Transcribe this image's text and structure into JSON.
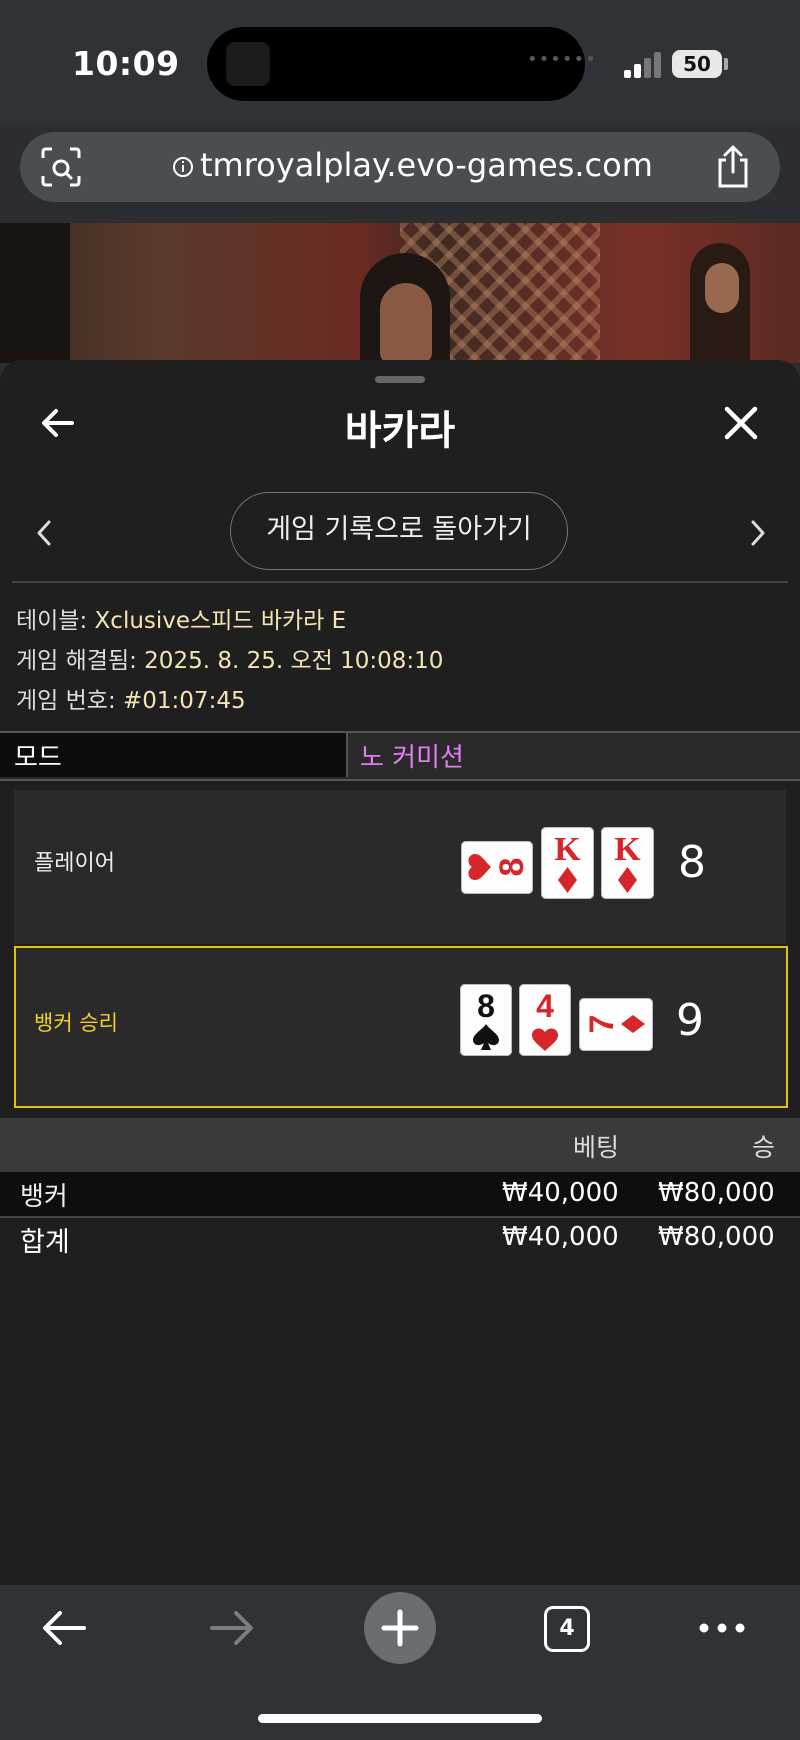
{
  "status_bar": {
    "time": "10:09",
    "battery": "50"
  },
  "browser": {
    "url": "tmroyalplay.evo-games.com"
  },
  "panel": {
    "title": "바카라",
    "history_button": "게임 기록으로 돌아가기",
    "info": {
      "table_label": "테이블: ",
      "table_value": "Xclusive스피드 바카라 E",
      "resolved_label": "게임 해결됨: ",
      "resolved_value": "2025. 8. 25. 오전 10:08:10",
      "round_label": "게임 번호: ",
      "round_value": "#01:07:45"
    },
    "mode": {
      "label": "모드",
      "value": "노 커미션"
    },
    "hands": {
      "player": {
        "label": "플레이어",
        "score": "8",
        "cards": [
          "8♥ (sideways)",
          "K♦",
          "K♦"
        ]
      },
      "banker": {
        "label": "뱅커 승리",
        "score": "9",
        "cards": [
          "8♠",
          "4♥",
          "7♦ (sideways)"
        ]
      }
    },
    "bets": {
      "headers": {
        "bet": "베팅",
        "win": "승"
      },
      "rows": [
        {
          "name": "뱅커",
          "bet": "₩40,000",
          "win": "₩80,000"
        }
      ],
      "total": {
        "name": "합계",
        "bet": "₩40,000",
        "win": "₩80,000"
      }
    }
  },
  "toolbar": {
    "tabs_count": "4"
  }
}
